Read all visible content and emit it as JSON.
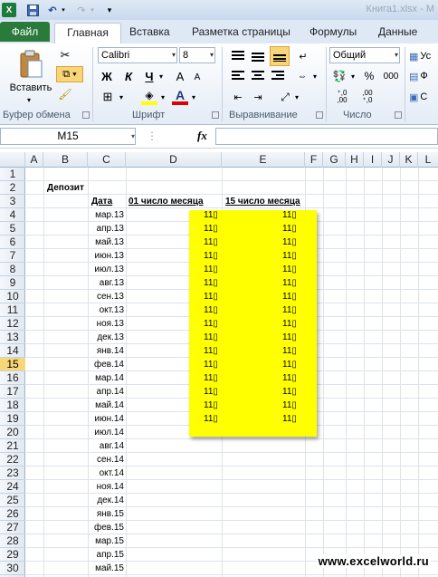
{
  "window": {
    "title": "Книга1.xlsx - M"
  },
  "tabs": [
    "Файл",
    "Главная",
    "Вставка",
    "Разметка страницы",
    "Формулы",
    "Данные"
  ],
  "ribbon": {
    "paste_label": "Вставить",
    "groups": {
      "clipboard": "Буфер обмена",
      "font": "Шрифт",
      "alignment": "Выравнивание",
      "number": "Число"
    },
    "font_name": "Calibri",
    "font_size": "8",
    "number_format": "Общий",
    "bold": "Ж",
    "italic": "К",
    "underline": "Ч",
    "grow_font": "A",
    "shrink_font": "A",
    "font_color_letter": "A",
    "percent": "%",
    "thousands": "000",
    "dec_inc": "⁺,0 ,00",
    "dec_dec": ",00 ⁺,0",
    "styles_cut": [
      "Ус",
      "Ф",
      "С"
    ]
  },
  "formula_bar": {
    "name_box": "M15",
    "fx": "fx",
    "formula": ""
  },
  "columns": [
    "A",
    "B",
    "C",
    "D",
    "E",
    "F",
    "G",
    "H",
    "I",
    "J",
    "K",
    "L"
  ],
  "rows": [
    "1",
    "2",
    "3",
    "4",
    "5",
    "6",
    "7",
    "8",
    "9",
    "10",
    "11",
    "12",
    "13",
    "14",
    "15",
    "16",
    "17",
    "18",
    "19",
    "20",
    "21",
    "22",
    "23",
    "24",
    "25",
    "26",
    "27",
    "28",
    "29",
    "30"
  ],
  "selected_row": "15",
  "sheet": {
    "deposit_label": "Депозит",
    "header_date": "Дата",
    "header_d": "01 число месяца",
    "header_e": "15 число месяца",
    "dates": [
      "мар.13",
      "апр.13",
      "май.13",
      "июн.13",
      "июл.13",
      "авг.13",
      "сен.13",
      "окт.13",
      "ноя.13",
      "дек.13",
      "янв.14",
      "фев.14",
      "мар.14",
      "апр.14",
      "май.14",
      "июн.14",
      "июл.14",
      "авг.14",
      "сен.14",
      "окт.14",
      "ноя.14",
      "дек.14",
      "янв.15",
      "фев.15",
      "мар.15",
      "апр.15",
      "май.15"
    ],
    "placeholder_value": "11▯",
    "yellow_color": "#ffff00"
  },
  "watermark": "www.excelworld.ru"
}
